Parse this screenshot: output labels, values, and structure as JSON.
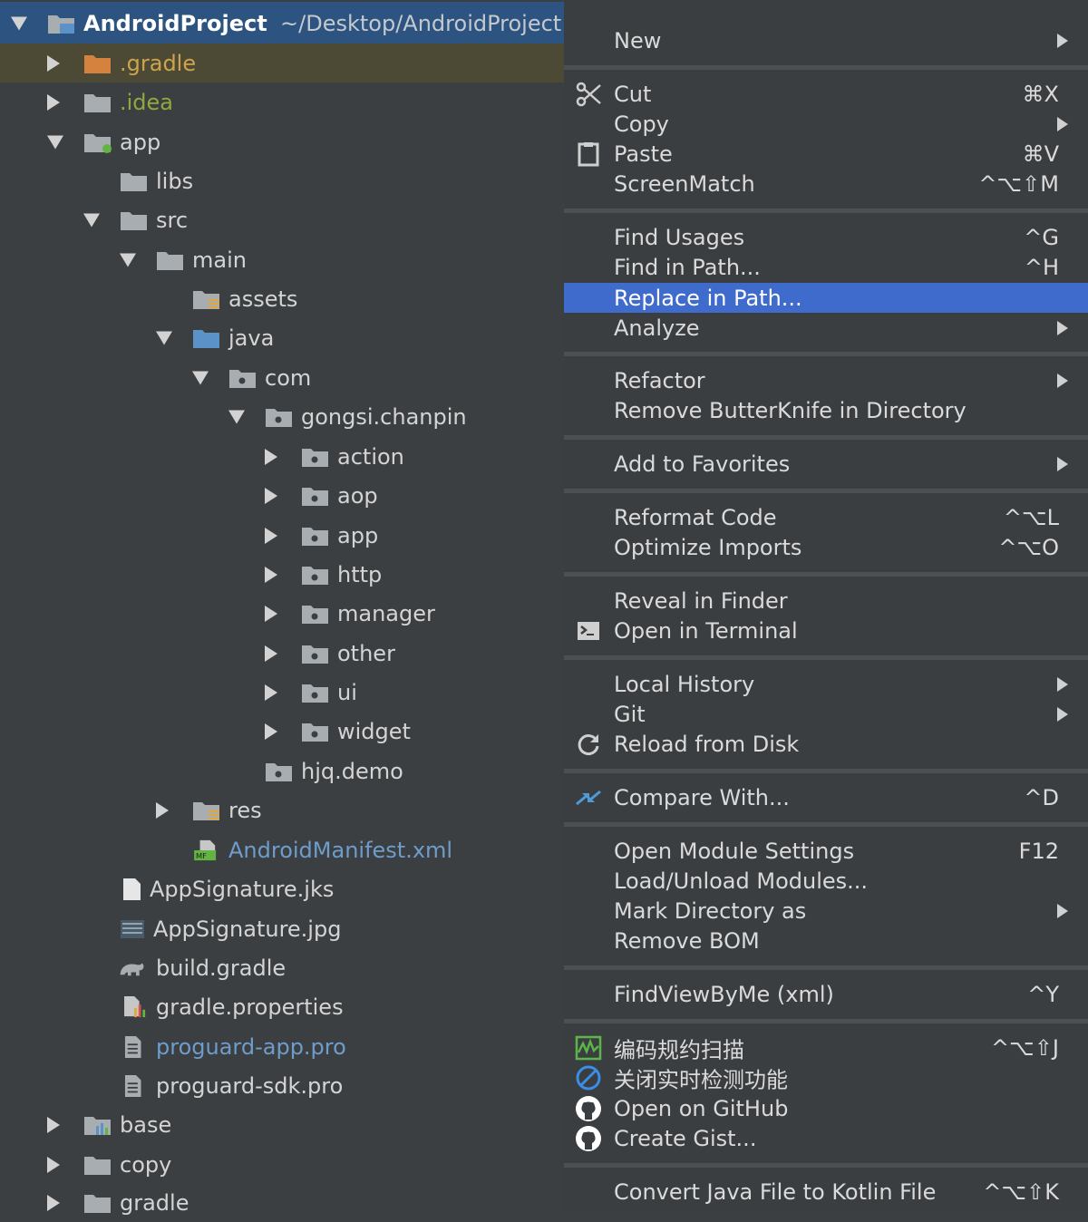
{
  "tree": {
    "root_name": "AndroidProject",
    "root_path": "~/Desktop/AndroidProject",
    "items": [
      {
        "label": ".gradle",
        "icon": "folder-orange-icon"
      },
      {
        "label": ".idea",
        "icon": "folder-icon"
      },
      {
        "label": "app",
        "icon": "module-folder-icon"
      },
      {
        "label": "libs",
        "icon": "folder-icon"
      },
      {
        "label": "src",
        "icon": "folder-icon"
      },
      {
        "label": "main",
        "icon": "folder-icon"
      },
      {
        "label": "assets",
        "icon": "resource-folder-icon"
      },
      {
        "label": "java",
        "icon": "source-folder-icon"
      },
      {
        "label": "com",
        "icon": "package-icon"
      },
      {
        "label": "gongsi.chanpin",
        "icon": "package-icon"
      },
      {
        "label": "action",
        "icon": "package-icon"
      },
      {
        "label": "aop",
        "icon": "package-icon"
      },
      {
        "label": "app",
        "icon": "package-icon"
      },
      {
        "label": "http",
        "icon": "package-icon"
      },
      {
        "label": "manager",
        "icon": "package-icon"
      },
      {
        "label": "other",
        "icon": "package-icon"
      },
      {
        "label": "ui",
        "icon": "package-icon"
      },
      {
        "label": "widget",
        "icon": "package-icon"
      },
      {
        "label": "hjq.demo",
        "icon": "package-icon"
      },
      {
        "label": "res",
        "icon": "resource-folder-icon"
      },
      {
        "label": "AndroidManifest.xml",
        "icon": "manifest-file-icon"
      },
      {
        "label": "AppSignature.jks",
        "icon": "file-icon"
      },
      {
        "label": "AppSignature.jpg",
        "icon": "image-file-icon"
      },
      {
        "label": "build.gradle",
        "icon": "gradle-elephant-icon"
      },
      {
        "label": "gradle.properties",
        "icon": "properties-file-icon"
      },
      {
        "label": "proguard-app.pro",
        "icon": "text-file-icon"
      },
      {
        "label": "proguard-sdk.pro",
        "icon": "text-file-icon"
      },
      {
        "label": "base",
        "icon": "module-folder-icon"
      },
      {
        "label": "copy",
        "icon": "folder-icon"
      },
      {
        "label": "gradle",
        "icon": "folder-icon"
      }
    ]
  },
  "menu": {
    "items": [
      {
        "label": "New",
        "shortcut": ""
      },
      {
        "label": "Cut",
        "shortcut": "⌘X",
        "icon": "scissors-icon"
      },
      {
        "label": "Copy",
        "shortcut": ""
      },
      {
        "label": "Paste",
        "shortcut": "⌘V",
        "icon": "clipboard-icon"
      },
      {
        "label": "ScreenMatch",
        "shortcut": "^⌥⇧M"
      },
      {
        "label": "Find Usages",
        "shortcut": "^G"
      },
      {
        "label": "Find in Path...",
        "shortcut": "^H"
      },
      {
        "label": "Replace in Path...",
        "shortcut": ""
      },
      {
        "label": "Analyze",
        "shortcut": ""
      },
      {
        "label": "Refactor",
        "shortcut": ""
      },
      {
        "label": "Remove ButterKnife in Directory",
        "shortcut": ""
      },
      {
        "label": "Add to Favorites",
        "shortcut": ""
      },
      {
        "label": "Reformat Code",
        "shortcut": "^⌥L"
      },
      {
        "label": "Optimize Imports",
        "shortcut": "^⌥O"
      },
      {
        "label": "Reveal in Finder",
        "shortcut": ""
      },
      {
        "label": "Open in Terminal",
        "shortcut": "",
        "icon": "terminal-icon"
      },
      {
        "label": "Local History",
        "shortcut": ""
      },
      {
        "label": "Git",
        "shortcut": ""
      },
      {
        "label": "Reload from Disk",
        "shortcut": "",
        "icon": "reload-icon"
      },
      {
        "label": "Compare With...",
        "shortcut": "^D",
        "icon": "compare-icon"
      },
      {
        "label": "Open Module Settings",
        "shortcut": "F12"
      },
      {
        "label": "Load/Unload Modules...",
        "shortcut": ""
      },
      {
        "label": "Mark Directory as",
        "shortcut": ""
      },
      {
        "label": "Remove BOM",
        "shortcut": ""
      },
      {
        "label": "FindViewByMe (xml)",
        "shortcut": "^Y"
      },
      {
        "label": "编码规约扫描",
        "shortcut": "^⌥⇧J",
        "icon": "code-scan-icon"
      },
      {
        "label": "关闭实时检测功能",
        "shortcut": "",
        "icon": "disable-circle-icon"
      },
      {
        "label": "Open on GitHub",
        "shortcut": "",
        "icon": "github-icon"
      },
      {
        "label": "Create Gist...",
        "shortcut": "",
        "icon": "github-icon"
      },
      {
        "label": "Convert Java File to Kotlin File",
        "shortcut": "^⌥⇧K"
      }
    ]
  },
  "colors": {
    "tree_bg": "#3c3f41",
    "root_selection": "#2d5381",
    "row_highlight": "#4c4a34",
    "menu_highlight": "#3e6bcc",
    "folder": "#a8adb2",
    "folder_orange": "#d4823d",
    "source_folder": "#5b92c7"
  }
}
